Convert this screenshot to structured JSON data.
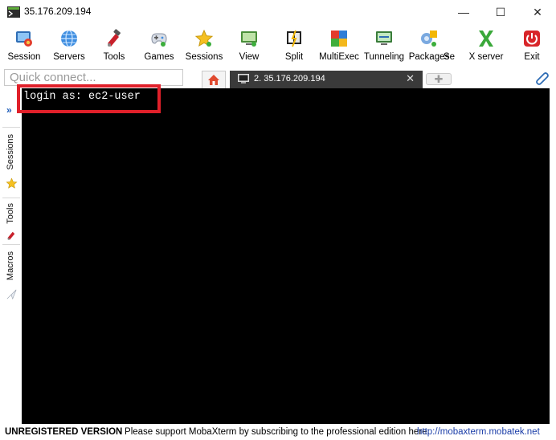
{
  "window": {
    "title": "35.176.209.194",
    "minimize_glyph": "—",
    "maximize_glyph": "☐",
    "close_glyph": "✕"
  },
  "toolbar": {
    "items": [
      {
        "label": "Session",
        "icon": "session-icon"
      },
      {
        "label": "Servers",
        "icon": "servers-icon"
      },
      {
        "label": "Tools",
        "icon": "tools-icon"
      },
      {
        "label": "Games",
        "icon": "games-icon"
      },
      {
        "label": "Sessions",
        "icon": "sessions-star-icon"
      },
      {
        "label": "View",
        "icon": "view-icon"
      },
      {
        "label": "Split",
        "icon": "split-icon"
      },
      {
        "label": "MultiExec",
        "icon": "multiexec-icon"
      },
      {
        "label": "Tunneling",
        "icon": "tunneling-icon"
      },
      {
        "label": "Packages",
        "icon": "packages-icon"
      },
      {
        "label": "Se",
        "icon": "settings-icon"
      },
      {
        "label": "X server",
        "icon": "x-server-icon"
      },
      {
        "label": "Exit",
        "icon": "exit-power-icon"
      }
    ]
  },
  "quick_connect": {
    "placeholder": "Quick connect..."
  },
  "tabs": {
    "session_label": "2. 35.176.209.194",
    "close_glyph": "✕",
    "new_tab_glyph": "✚"
  },
  "sidebar": {
    "tabs": [
      "Sessions",
      "Tools",
      "Macros"
    ]
  },
  "terminal": {
    "lines": [
      "login as: ec2-user"
    ]
  },
  "status": {
    "unregistered": "UNREGISTERED VERSION",
    "message": "-  Please support MobaXterm by subscribing to the professional edition here:",
    "link": "http://mobaxterm.mobatek.net"
  },
  "colors": {
    "terminal_bg": "#000000",
    "terminal_fg": "#ffffff",
    "highlight": "#e0202a",
    "link": "#1a3da8"
  }
}
